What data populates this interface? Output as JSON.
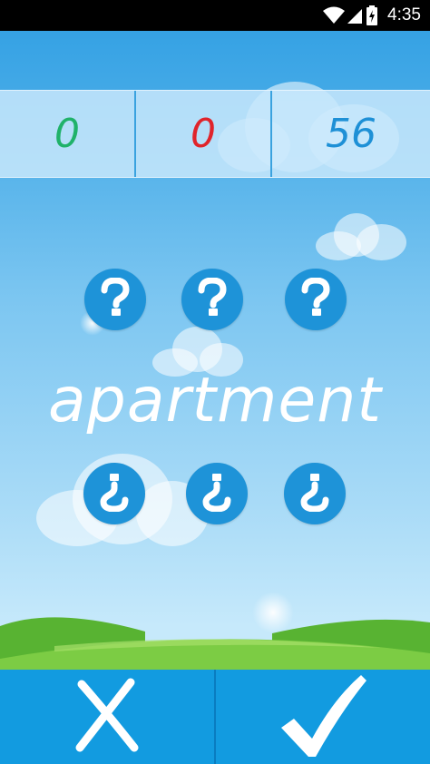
{
  "status_bar": {
    "time": "4:35",
    "icons": [
      "wifi-icon",
      "cell-signal-icon",
      "battery-charging-icon"
    ]
  },
  "scores": {
    "correct": "0",
    "wrong": "0",
    "timer": "56",
    "colors": {
      "correct": "#20b26a",
      "wrong": "#e0242b",
      "timer": "#1e90d6"
    }
  },
  "word": "apartment",
  "top_buttons": [
    {
      "icon": "question-mark-icon"
    },
    {
      "icon": "question-mark-icon"
    },
    {
      "icon": "question-mark-icon"
    }
  ],
  "bottom_buttons": [
    {
      "icon": "inverted-question-mark-icon"
    },
    {
      "icon": "inverted-question-mark-icon"
    },
    {
      "icon": "inverted-question-mark-icon"
    }
  ],
  "actions": {
    "reject_icon": "cross-icon",
    "accept_icon": "checkmark-icon"
  },
  "colors": {
    "button_blue": "#1e93d8",
    "bottom_bar": "#129be0",
    "grass": "#6cc23a"
  }
}
